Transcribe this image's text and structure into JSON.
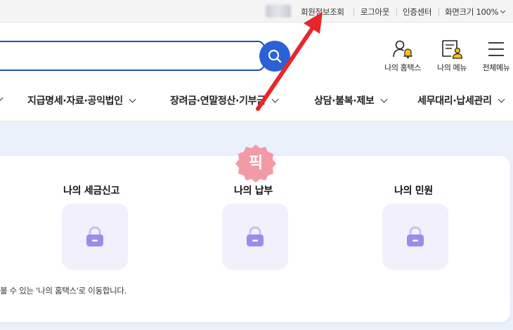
{
  "topbar": {
    "links": [
      "회원정보조회",
      "로그아웃",
      "인증센터",
      "화면크기 100%"
    ]
  },
  "search": {
    "placeholder": ""
  },
  "quick_icons": [
    {
      "label": "나의 홈택스",
      "icon": "user-bell-icon"
    },
    {
      "label": "나의 메뉴",
      "icon": "document-user-icon"
    },
    {
      "label": "전체메뉴",
      "icon": "hamburger-icon"
    }
  ],
  "menu": {
    "items": [
      "지급명세·자료·공익법인",
      "장려금·연말정산·기부금",
      "상담·불복·제보",
      "세무대리·납세관리"
    ]
  },
  "sections": {
    "titles": [
      "나의 세금신고",
      "나의 납부",
      "나의 민원"
    ],
    "note": "볼 수 있는 '나의 홈택스'로 이동합니다."
  },
  "sticker": {
    "text": "픽"
  },
  "colors": {
    "brand_blue": "#2a62d6",
    "search_border": "#1f4fb8",
    "lock_purple": "#9a8ce8",
    "annotation_red": "#e8262a",
    "sticker_pink": "#f29aa6"
  }
}
